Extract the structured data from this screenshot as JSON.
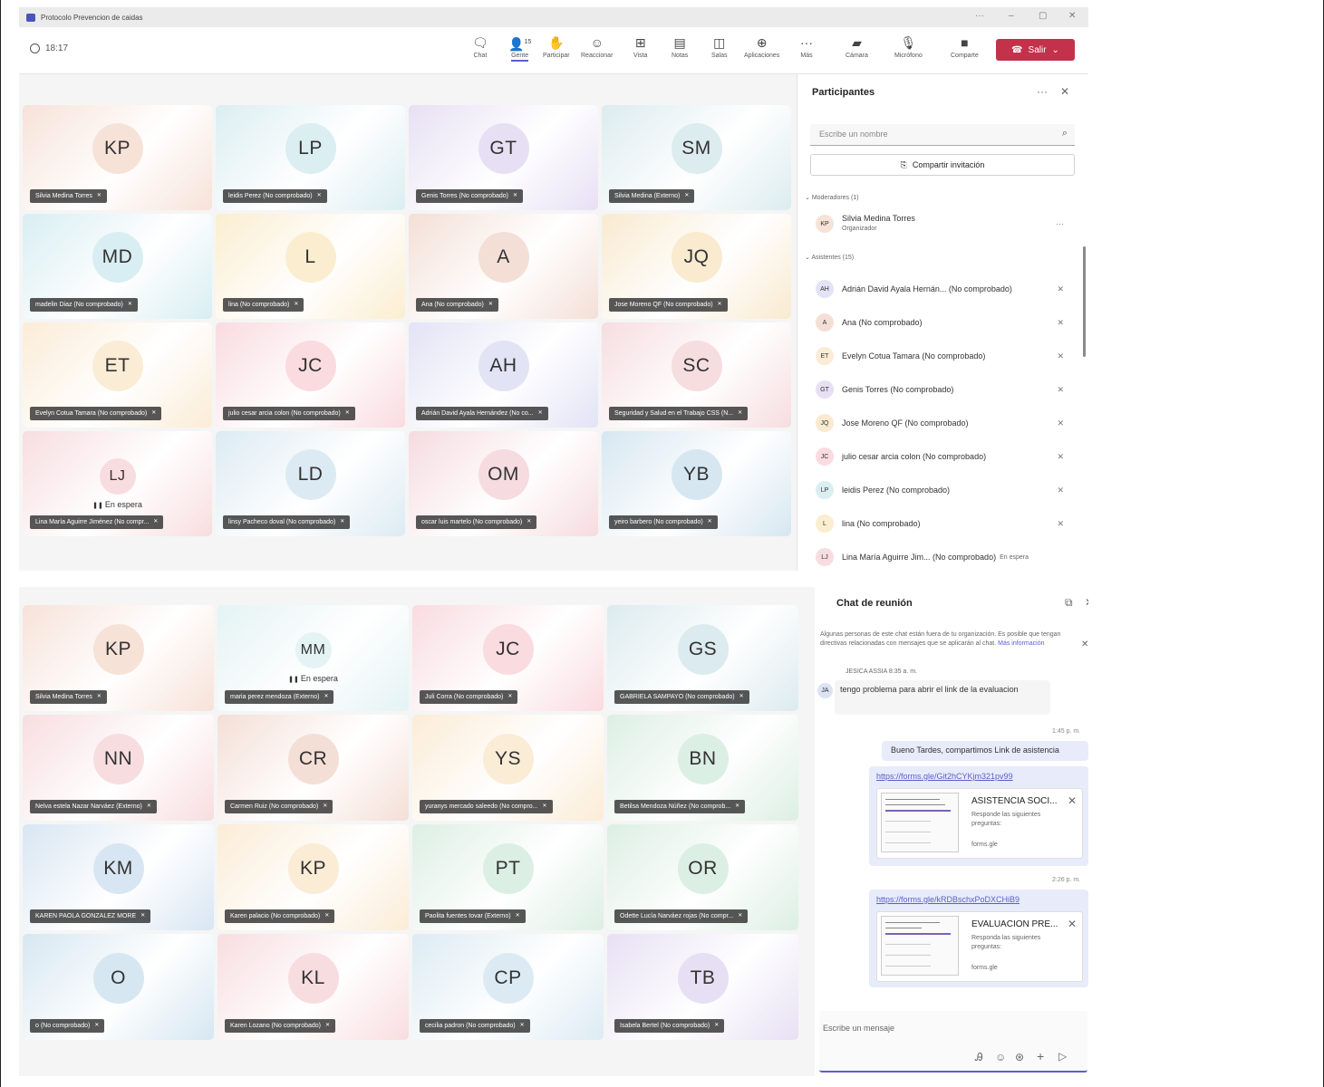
{
  "app": {
    "window_title": "Protocolo Prevencion de caidas",
    "timer": "18:17"
  },
  "toolbar": {
    "chat": "Chat",
    "people_count": "15",
    "people": "Gente",
    "raise": "Participar",
    "react": "Reaccionar",
    "view": "Vista",
    "notes": "Notas",
    "rooms": "Salas",
    "apps": "Aplicaciones",
    "more": "Más",
    "camera": "Cámara",
    "mic": "Micrófono",
    "share": "Comparte",
    "leave": "Salir"
  },
  "grid1": [
    {
      "initials": "KP",
      "name": "Silvia Medina Torres",
      "bg": "#f7e2d8"
    },
    {
      "initials": "LP",
      "name": "leidis Perez (No comprobado)",
      "bg": "#dbeef2"
    },
    {
      "initials": "GT",
      "name": "Genis Torres (No comprobado)",
      "bg": "#e7e0f4"
    },
    {
      "initials": "SM",
      "name": "Silvia Medina (Externo)",
      "bg": "#dcecef"
    },
    {
      "initials": "MD",
      "name": "madelin Diaz (No comprobado)",
      "bg": "#d8eef2"
    },
    {
      "initials": "L",
      "name": "lina (No comprobado)",
      "bg": "#fbeed0"
    },
    {
      "initials": "A",
      "name": "Ana (No comprobado)",
      "bg": "#f4dfd6"
    },
    {
      "initials": "JQ",
      "name": "Jose Moreno QF (No comprobado)",
      "bg": "#f9ead0"
    },
    {
      "initials": "ET",
      "name": "Evelyn Cotua Tamara (No comprobado)",
      "bg": "#fbecd6"
    },
    {
      "initials": "JC",
      "name": "julio cesar arcia colon (No comprobado)",
      "bg": "#f9dbe0"
    },
    {
      "initials": "AH",
      "name": "Adrián David Ayala Hernández (No co...",
      "bg": "#e2e3f5"
    },
    {
      "initials": "SC",
      "name": "Seguridad y Salud en el Trabajo CSS (N...",
      "bg": "#f6dde0"
    },
    {
      "initials": "LJ",
      "name": "Lina María Aguirre Jiménez (No compr...",
      "bg": "#f8dde0",
      "hold": "En espera",
      "small": true
    },
    {
      "initials": "LD",
      "name": "linsy Pacheco doval (No comprobado)",
      "bg": "#dcebf3"
    },
    {
      "initials": "OM",
      "name": "oscar luis martelo (No comprobado)",
      "bg": "#f6dbe0"
    },
    {
      "initials": "YB",
      "name": "yeiro barbero (No comprobado)",
      "bg": "#d6e7f1"
    }
  ],
  "participants": {
    "title": "Participantes",
    "search_placeholder": "Escribe un nombre",
    "invite": "Compartir invitación",
    "moderators_header": "Moderadores (1)",
    "moderator": {
      "initials": "KP",
      "name": "Silvia Medina Torres",
      "role": "Organizador",
      "bg": "#f7e2d8"
    },
    "attendees_header": "Asistentes (15)",
    "attendees": [
      {
        "initials": "AH",
        "name": "Adrián David Ayala Hernán... (No comprobado)",
        "bg": "#e2e3f5"
      },
      {
        "initials": "A",
        "name": "Ana (No comprobado)",
        "bg": "#f4dfd6"
      },
      {
        "initials": "ET",
        "name": "Evelyn Cotua Tamara (No comprobado)",
        "bg": "#fbecd6"
      },
      {
        "initials": "GT",
        "name": "Genis Torres (No comprobado)",
        "bg": "#e7e0f4"
      },
      {
        "initials": "JQ",
        "name": "Jose Moreno QF (No comprobado)",
        "bg": "#f9ead0"
      },
      {
        "initials": "JC",
        "name": "julio cesar arcia colon (No comprobado)",
        "bg": "#f9dbe0"
      },
      {
        "initials": "LP",
        "name": "leidis Perez (No comprobado)",
        "bg": "#dbeef2"
      },
      {
        "initials": "L",
        "name": "lina (No comprobado)",
        "bg": "#fbeed0"
      },
      {
        "initials": "LJ",
        "name": "Lina María Aguirre Jim... (No comprobado)",
        "bg": "#f8dde0",
        "status": "En espera"
      }
    ]
  },
  "grid2": [
    {
      "initials": "KP",
      "name": "Silvia Medina Torres",
      "bg": "#f7e2d8"
    },
    {
      "initials": "MM",
      "name": "maria perez mendoza (Externo)",
      "bg": "#e4f3f4",
      "hold": "En espera",
      "small": true
    },
    {
      "initials": "JC",
      "name": "Juli Corra (No comprobado)",
      "bg": "#f9dbe0"
    },
    {
      "initials": "GS",
      "name": "GABRIELA SAMPAYO (No comprobado)",
      "bg": "#dcebef"
    },
    {
      "initials": "NN",
      "name": "Nelva estela Nazar Narváez (Externo)",
      "bg": "#f8dde0"
    },
    {
      "initials": "CR",
      "name": "Carmen Ruiz (No comprobado)",
      "bg": "#f4dfd6"
    },
    {
      "initials": "YS",
      "name": "yuranys mercado saleedo (No compro...",
      "bg": "#fbecd6"
    },
    {
      "initials": "BN",
      "name": "Betilsa Mendoza Núñez (No comprob...",
      "bg": "#dcefe4"
    },
    {
      "initials": "KM",
      "name": "KAREN PAOLA GONZALEZ MORE",
      "bg": "#d8e6f3"
    },
    {
      "initials": "KP",
      "name": "Karen palacio (No comprobado)",
      "bg": "#fbecd6"
    },
    {
      "initials": "PT",
      "name": "Paolita fuentes tovar (Externo)",
      "bg": "#dcefe4"
    },
    {
      "initials": "OR",
      "name": "Odette Lucía Narváez rojas (No compr...",
      "bg": "#dcefe4"
    },
    {
      "initials": "O",
      "name": "o (No comprobado)",
      "bg": "#d6e7f1"
    },
    {
      "initials": "KL",
      "name": "Karen Lozano (No comprobado)",
      "bg": "#f8dde0"
    },
    {
      "initials": "CP",
      "name": "cecilia padron (No comprobado)",
      "bg": "#dcebf3"
    },
    {
      "initials": "TB",
      "name": "Isabela Bertel (No comprobado)",
      "bg": "#e7e0f4"
    }
  ],
  "chat": {
    "title": "Chat de reunión",
    "notice": "Algunas personas de este chat están fuera de tu organización. Es posible que tengan directivas relacionadas con mensajes que se aplicarán al chat.",
    "notice_link": "Más información",
    "msg1_meta": "JESICA ASSIA  8:35 a. m.",
    "msg1_avatar": "JA",
    "msg1_text": "tengo problema para  abrir el link  de la evaluacion",
    "time2": "1:45 p. m.",
    "msg2_text": "Bueno Tardes, compartimos Link de asistencia",
    "link1": "https://forms.gle/Git2hCYKjm321pv99",
    "card1_title": "ASISTENCIA SOCI...",
    "card1_sub": "Responde las siguientes preguntas:",
    "card1_domain": "forms.gle",
    "time3": "2:26 p. m.",
    "link2": "https://forms.gle/kRDBschxPoDXCHiB9",
    "card2_title": "EVALUACION PRE...",
    "card2_sub": "Responda las siguientes preguntas:",
    "card2_domain": "forms.gle",
    "compose_placeholder": "Escribe un mensaje"
  }
}
